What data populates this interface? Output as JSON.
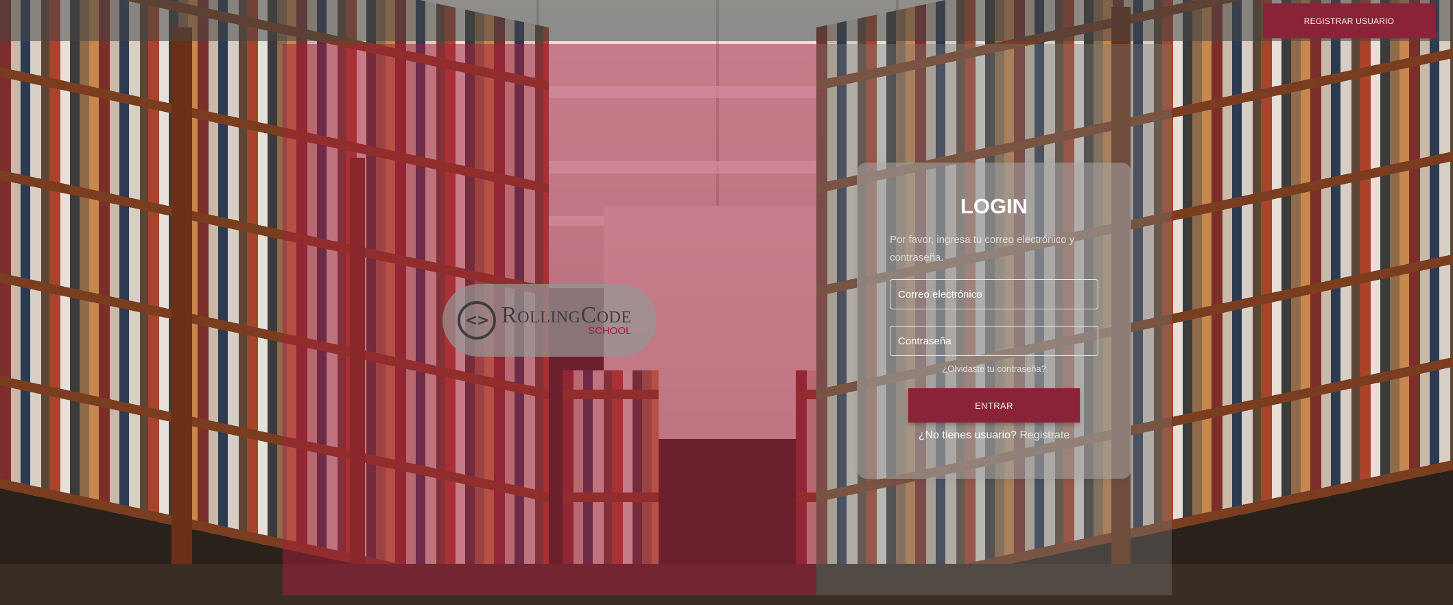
{
  "header": {
    "register_button": "REGISTRAR USUARIO"
  },
  "brand": {
    "logo_mark": "<>",
    "name": "RollingCode",
    "tagline": "SCHOOL"
  },
  "login": {
    "title": "LOGIN",
    "description": "Por favor, ingresa tu correo electrónico y contraseña.",
    "email_placeholder": "Correo electrónico",
    "password_placeholder": "Contraseña",
    "forgot_password": "¿Olvidaste tu contraseña?",
    "submit": "ENTRAR",
    "no_account": "¿No tienes usuario?",
    "signup_link": "Registrate"
  },
  "colors": {
    "accent": "#8b2338",
    "panel_overlay": "#a81e3e",
    "logo_text": "#3d3d3d",
    "logo_tagline": "#a31e32"
  }
}
